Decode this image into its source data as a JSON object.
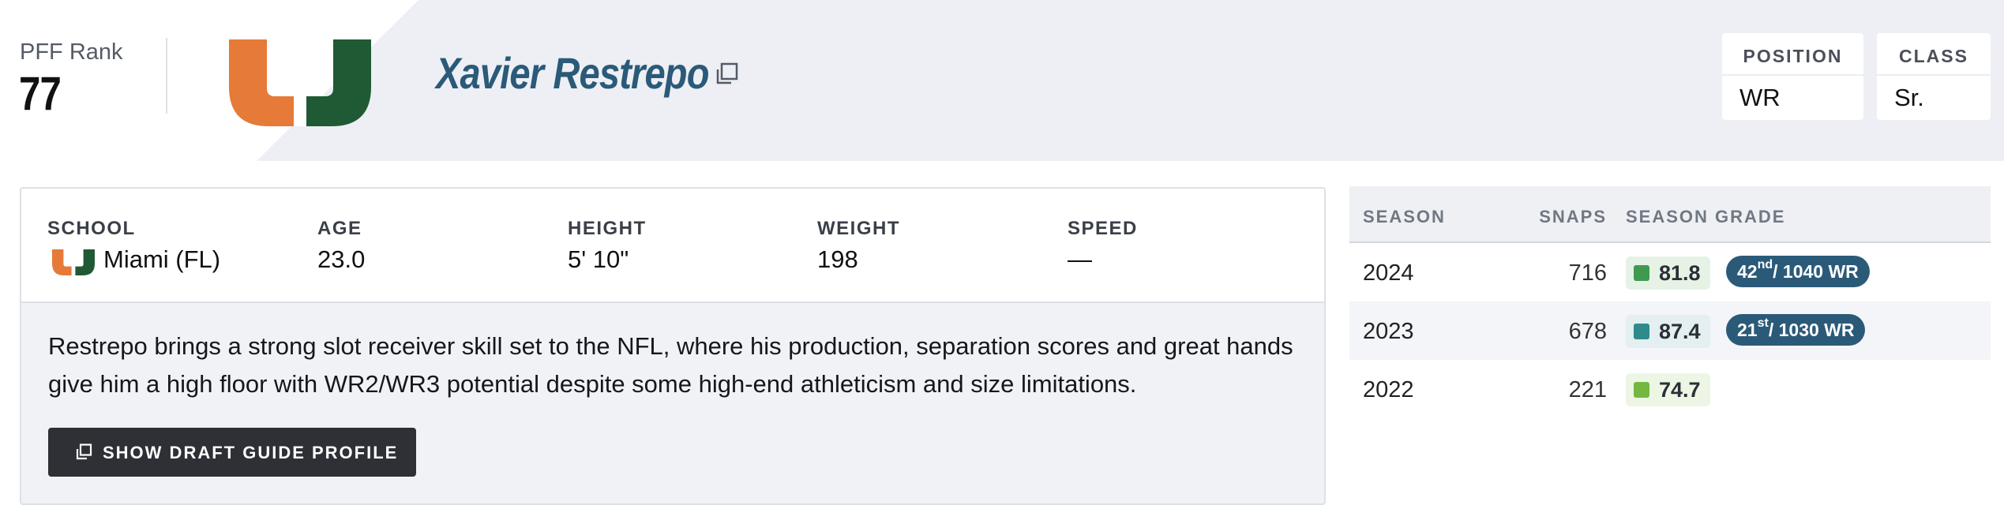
{
  "header": {
    "rank_label": "PFF Rank",
    "rank_value": "77",
    "player_name": "Xavier Restrepo",
    "position": {
      "label": "POSITION",
      "value": "WR"
    },
    "class": {
      "label": "CLASS",
      "value": "Sr."
    }
  },
  "details": {
    "school": {
      "label": "SCHOOL",
      "value": "Miami (FL)"
    },
    "age": {
      "label": "AGE",
      "value": "23.0"
    },
    "height": {
      "label": "HEIGHT",
      "value": "5' 10\""
    },
    "weight": {
      "label": "WEIGHT",
      "value": "198"
    },
    "speed": {
      "label": "SPEED",
      "value": "—"
    },
    "summary": "Restrepo brings a strong slot receiver skill set to the NFL, where his production, separation scores and great hands give him a high floor with WR2/WR3 potential despite some high-end athleticism and size limitations.",
    "button_label": "SHOW DRAFT GUIDE PROFILE"
  },
  "seasons": {
    "headers": {
      "season": "SEASON",
      "snaps": "SNAPS",
      "grade": "SEASON GRADE"
    },
    "rows": [
      {
        "season": "2024",
        "snaps": "716",
        "grade": "81.8",
        "grade_color": "#3f9a4f",
        "grade_bg": "#e6f2e6",
        "rank_num": "42",
        "rank_suffix": "nd",
        "rank_rest": " / 1040 WR"
      },
      {
        "season": "2023",
        "snaps": "678",
        "grade": "87.4",
        "grade_color": "#2f8a8c",
        "grade_bg": "#e3eff0",
        "rank_num": "21",
        "rank_suffix": "st",
        "rank_rest": " / 1030 WR"
      },
      {
        "season": "2022",
        "snaps": "221",
        "grade": "74.7",
        "grade_color": "#74b842",
        "grade_bg": "#edf6e5"
      }
    ]
  },
  "icons": {
    "team_logo": "miami-u-logo",
    "name_link": "external-link-icon",
    "button": "external-link-icon"
  },
  "colors": {
    "miami_orange": "#e67a38",
    "miami_green": "#1f5a34",
    "name_blue": "#2b5a79",
    "button_dark": "#2e3035",
    "rank_pill": "#2b5a79"
  }
}
